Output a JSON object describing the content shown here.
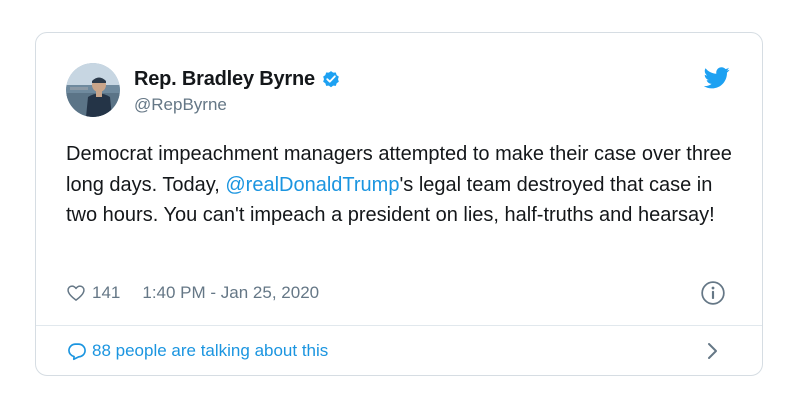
{
  "author": {
    "display_name": "Rep. Bradley Byrne",
    "handle": "@RepByrne",
    "verified": true
  },
  "tweet": {
    "text_part1": "Democrat impeachment managers attempted to make their case over three long days. Today, ",
    "mention": "@realDonaldTrump",
    "text_part2": "'s legal team destroyed that case in two hours. You can't impeach a president on lies, half-truths and hearsay!"
  },
  "meta": {
    "like_count": "141",
    "timestamp": "1:40 PM - Jan 25, 2020"
  },
  "footer": {
    "conversation_label": "88 people are talking about this"
  },
  "colors": {
    "accent": "#1b95e0",
    "text": "#14171a",
    "secondary": "#657786",
    "border": "#d6dde3"
  },
  "icons": [
    "verified-icon",
    "twitter-bird-icon",
    "heart-icon",
    "info-icon",
    "reply-icon",
    "chevron-right-icon"
  ]
}
